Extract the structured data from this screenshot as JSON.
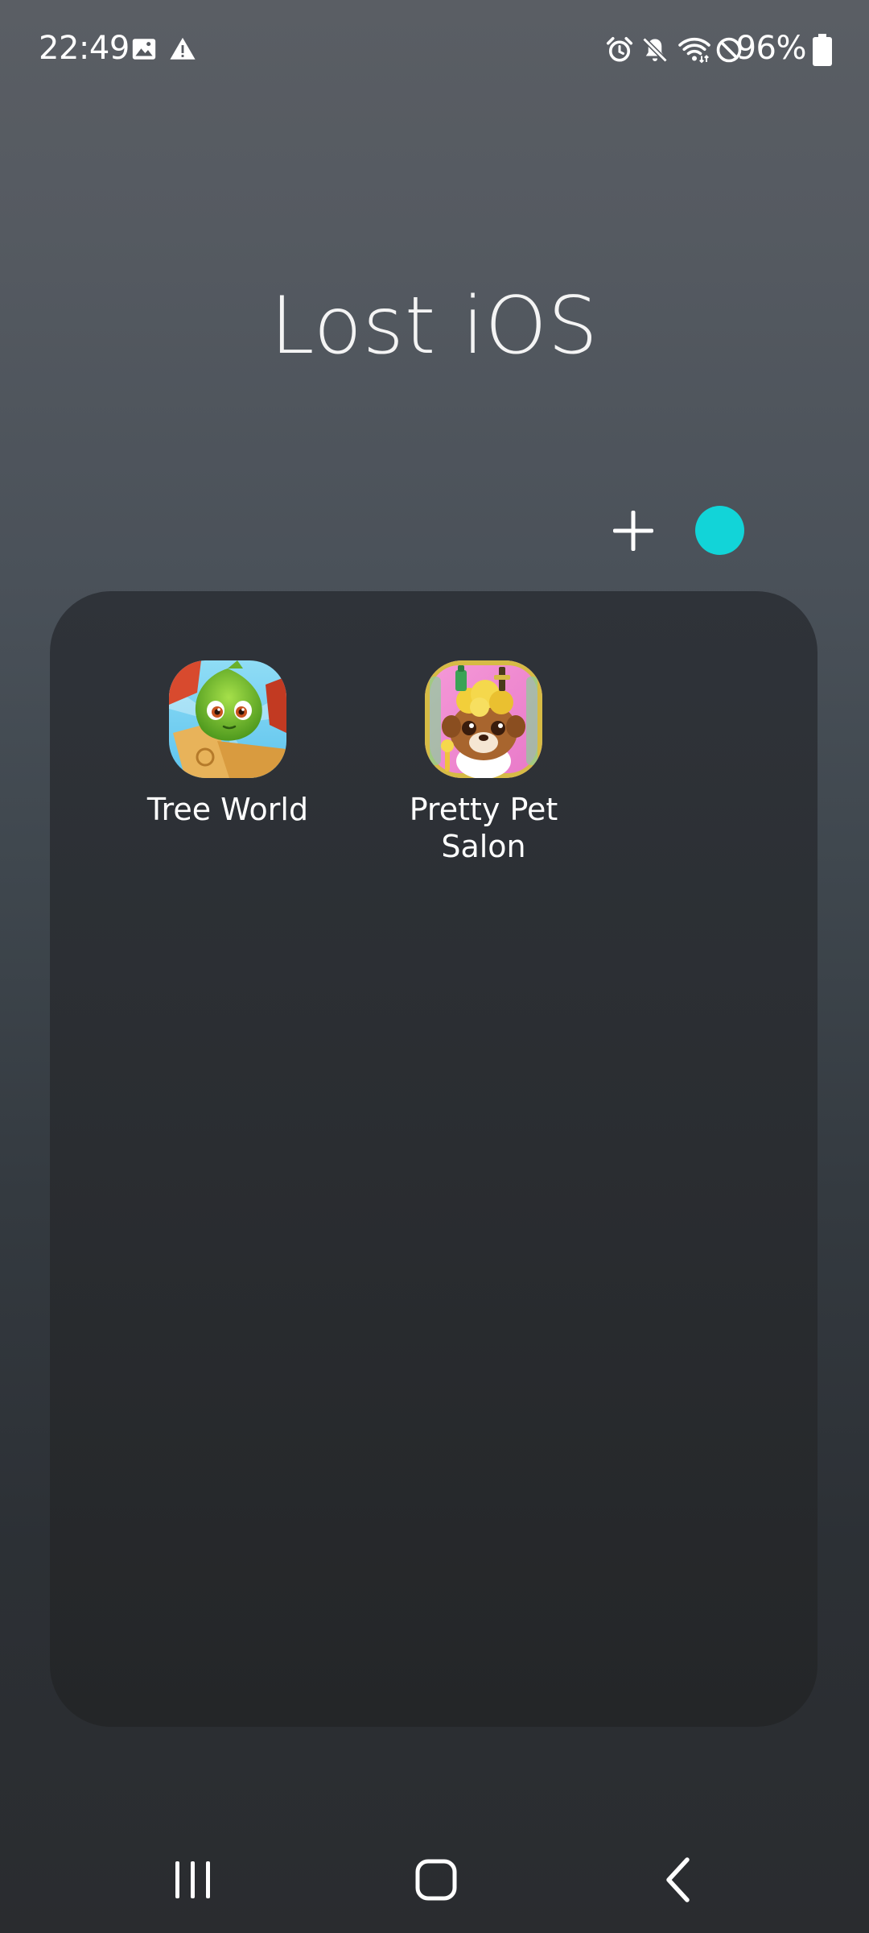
{
  "status_bar": {
    "time": "22:49",
    "left_icons": [
      "image-icon",
      "warning-icon"
    ],
    "right_icons": [
      "alarm-icon",
      "mute-icon",
      "wifi-icon",
      "do-not-disturb-icon",
      "battery-icon"
    ],
    "battery_percent": "96%",
    "battery_level": 0.96
  },
  "folder": {
    "title": "Lost iOS",
    "add_icon": "plus-icon",
    "color_swatch": "#12d4d8",
    "apps": [
      {
        "label": "Tree World",
        "icon": "tree-world-app-icon"
      },
      {
        "label": "Pretty Pet Salon",
        "icon": "pretty-pet-salon-app-icon"
      }
    ]
  },
  "nav_bar": {
    "recents_icon": "recents-icon",
    "home_icon": "home-icon",
    "back_icon": "back-icon"
  },
  "colors": {
    "accent": "#12d4d8",
    "panel": "#2b2e33",
    "text": "#ffffff"
  }
}
